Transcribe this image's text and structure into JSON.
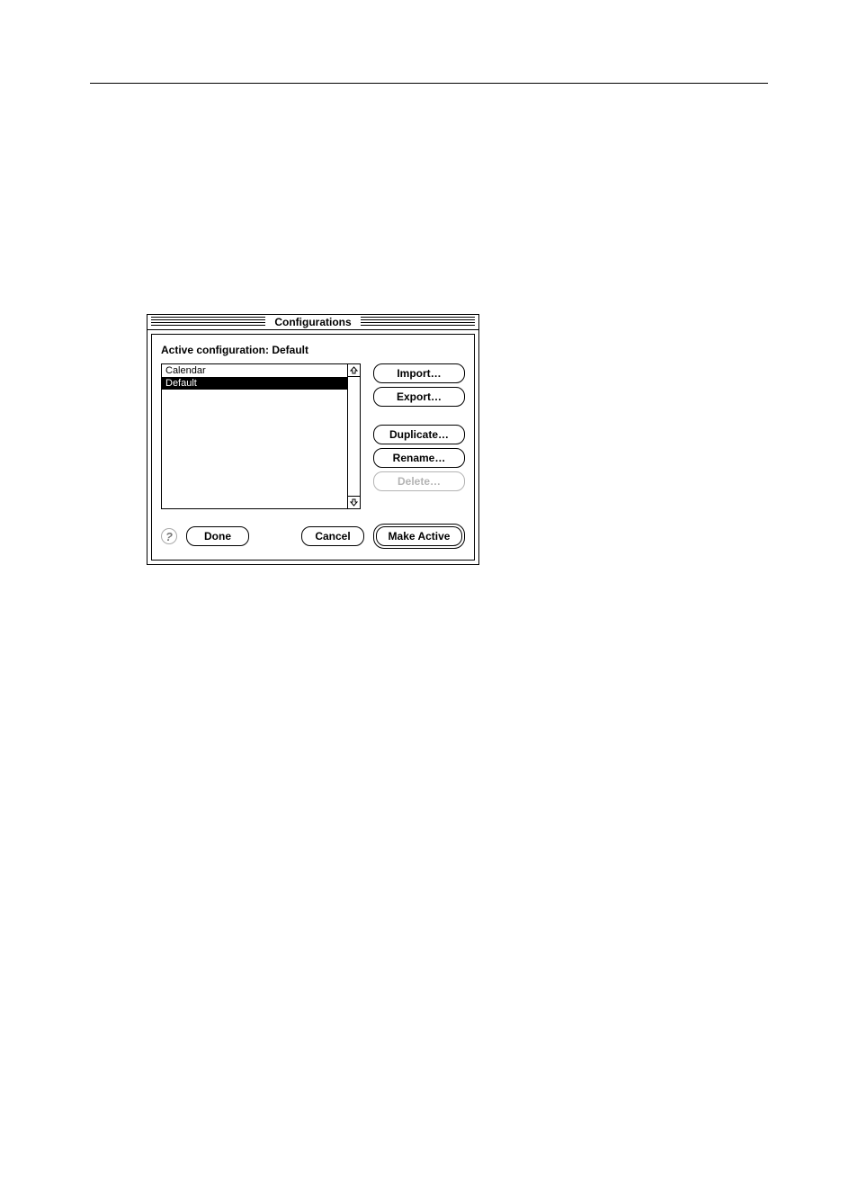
{
  "dialog": {
    "title": "Configurations",
    "active_label": "Active configuration: Default",
    "list_items": [
      {
        "label": "Calendar",
        "selected": false
      },
      {
        "label": "Default",
        "selected": true
      }
    ],
    "buttons": {
      "import": "Import…",
      "export": "Export…",
      "duplicate": "Duplicate…",
      "rename": "Rename…",
      "delete": "Delete…",
      "done": "Done",
      "cancel": "Cancel",
      "make_active": "Make Active"
    },
    "delete_enabled": false
  }
}
